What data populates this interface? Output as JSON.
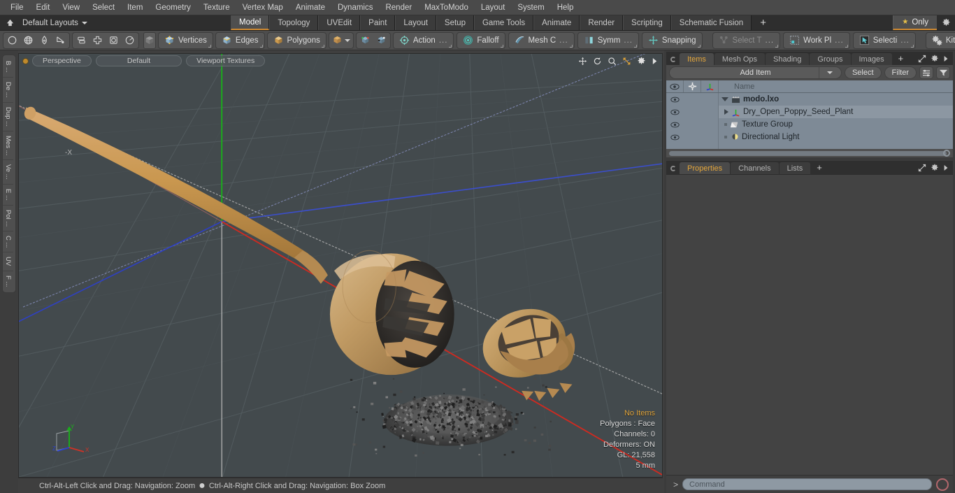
{
  "menubar": {
    "items": [
      "File",
      "Edit",
      "View",
      "Select",
      "Item",
      "Geometry",
      "Texture",
      "Vertex Map",
      "Animate",
      "Dynamics",
      "Render",
      "MaxToModo",
      "Layout",
      "System",
      "Help"
    ]
  },
  "layoutbar": {
    "home_icon": "home-icon",
    "layouts_label": "Default Layouts",
    "tabs": [
      {
        "label": "Model",
        "active": true
      },
      {
        "label": "Topology",
        "active": false
      },
      {
        "label": "UVEdit",
        "active": false
      },
      {
        "label": "Paint",
        "active": false
      },
      {
        "label": "Layout",
        "active": false
      },
      {
        "label": "Setup",
        "active": false
      },
      {
        "label": "Game Tools",
        "active": false
      },
      {
        "label": "Animate",
        "active": false
      },
      {
        "label": "Render",
        "active": false
      },
      {
        "label": "Scripting",
        "active": false
      },
      {
        "label": "Schematic Fusion",
        "active": false
      }
    ],
    "add_tab_label": "+",
    "only_label": "Only",
    "gear_icon": "gear-icon"
  },
  "toolbar": {
    "icon_group_1": [
      "circle-icon",
      "globe-icon",
      "pen-icon",
      "curve-icon"
    ],
    "icon_group_2": [
      "align-icon",
      "plus-cube-icon",
      "square-circle-icon",
      "radial-icon"
    ],
    "mode_icon": "cube-icon",
    "selection_modes": [
      {
        "label": "Vertices",
        "icon": "vertices-cube-icon"
      },
      {
        "label": "Edges",
        "icon": "edges-cube-icon"
      },
      {
        "label": "Polygons",
        "icon": "polygons-cube-icon"
      }
    ],
    "item_mode_icon": "item-cube-icon",
    "snap_icons": [
      "snap-vertex-icon",
      "snap-poly-icon"
    ],
    "tools": [
      {
        "label": "Action",
        "suffix": "...",
        "icon": "action-center-icon",
        "dim": false
      },
      {
        "label": "Falloff",
        "suffix": "",
        "icon": "falloff-icon",
        "dim": false
      },
      {
        "label": "Mesh C",
        "suffix": "...",
        "icon": "mesh-constraint-icon",
        "dim": false
      },
      {
        "label": "Symm",
        "suffix": "...",
        "icon": "symmetry-icon",
        "dim": false
      },
      {
        "label": "Snapping",
        "suffix": "",
        "icon": "snapping-icon",
        "dim": false
      },
      {
        "label": "Select T",
        "suffix": "...",
        "icon": "select-through-icon",
        "dim": true
      },
      {
        "label": "Work Pl",
        "suffix": "...",
        "icon": "work-plane-icon",
        "dim": false
      },
      {
        "label": "Selecti",
        "suffix": "...",
        "icon": "selection-set-icon",
        "dim": false
      },
      {
        "label": "Kits",
        "suffix": "",
        "icon": "kits-gears-icon",
        "dim": false
      }
    ],
    "export_buttons": [
      {
        "icon": "unity-cube-icon",
        "name": "unity-export-button"
      },
      {
        "icon": "unreal-engine-icon",
        "name": "unreal-export-button"
      }
    ]
  },
  "left_rail": {
    "tabs": [
      "B ...",
      "De ...",
      "Dup ...",
      "Mes ...",
      "Ve ...",
      "E ...",
      "Pol ...",
      "C ...",
      "UV",
      "F ..."
    ]
  },
  "viewport": {
    "projection_label": "Perspective",
    "style_label": "Default",
    "shading_label": "Viewport Textures",
    "header_icons": [
      "pan-icon",
      "rotate-icon",
      "zoom-icon",
      "fit-icon",
      "gear-icon",
      "expand-arrow-icon"
    ],
    "axis_gizmo": {
      "x_label": "X",
      "y_label": "Y",
      "z_label": "Z"
    },
    "negative_x_label": "-X",
    "info": {
      "selection": "No Items",
      "polygons": "Polygons : Face",
      "channels": "Channels: 0",
      "deformers": "Deformers: ON",
      "gl": "GL: 21,558",
      "grid": "5 mm"
    },
    "colors": {
      "background": "#434a4d",
      "axis_x": "#d02a20",
      "axis_y": "#17b417",
      "axis_z": "#2c3fd0",
      "grid": "#545c60",
      "model": "#c79b60",
      "seeds": "#4a4a4a"
    }
  },
  "statusbar": {
    "hint_left": "Ctrl-Alt-Left Click and Drag: Navigation: Zoom",
    "separator": "●",
    "hint_right": "Ctrl-Alt-Right Click and Drag: Navigation: Box Zoom"
  },
  "items_panel": {
    "tabs": [
      {
        "label": "Items",
        "active": true
      },
      {
        "label": "Mesh Ops",
        "active": false
      },
      {
        "label": "Shading",
        "active": false
      },
      {
        "label": "Groups",
        "active": false
      },
      {
        "label": "Images",
        "active": false
      }
    ],
    "add_tab_label": "+",
    "panel_icons": [
      "expand-icon",
      "gear-icon",
      "arrow-right-icon"
    ],
    "add_item_label": "Add Item",
    "select_label": "Select",
    "filter_label": "Filter",
    "micro_icons": [
      "list-options-icon",
      "funnel-icon"
    ],
    "column_headers": {
      "visibility": "eye-icon",
      "lock": "crosshair-icon",
      "transform": "axis-icon",
      "name": "Name"
    },
    "tree": [
      {
        "label": "modo.lxo",
        "icon": "scene-icon",
        "depth": 0,
        "expander": "down",
        "bold": true,
        "selected": false
      },
      {
        "label": "Dry_Open_Poppy_Seed_Plant",
        "icon": "mesh-axis-icon",
        "depth": 1,
        "expander": "right",
        "bold": false,
        "selected": true
      },
      {
        "label": "Texture Group",
        "icon": "texture-group-icon",
        "depth": 1,
        "expander": "dot",
        "bold": false,
        "selected": false
      },
      {
        "label": "Directional Light",
        "icon": "light-icon",
        "depth": 1,
        "expander": "dot",
        "bold": false,
        "selected": false
      }
    ]
  },
  "properties_panel": {
    "tabs": [
      {
        "label": "Properties",
        "active": true
      },
      {
        "label": "Channels",
        "active": false
      },
      {
        "label": "Lists",
        "active": false
      }
    ],
    "add_tab_label": "+",
    "panel_icons": [
      "expand-icon",
      "gear-icon",
      "arrow-right-icon"
    ]
  },
  "command_line": {
    "prompt": "&gt;",
    "placeholder": "Command",
    "record_icon": "record-icon"
  }
}
